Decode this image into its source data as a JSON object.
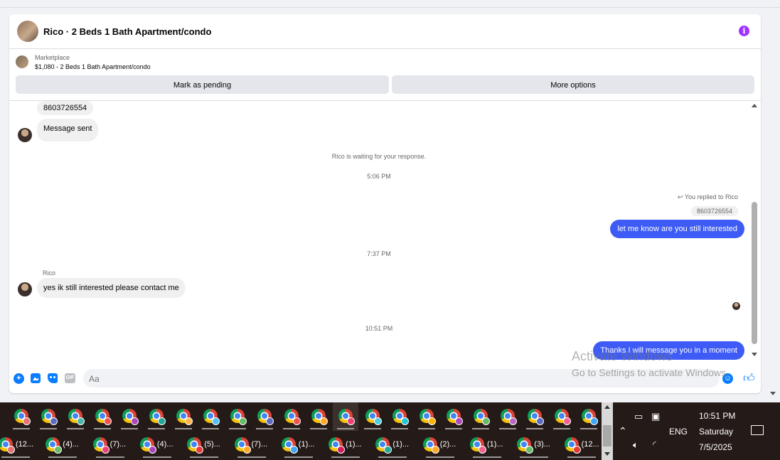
{
  "header": {
    "title": "Rico · 2 Beds 1 Bath Apartment/condo",
    "info_icon": "info-icon"
  },
  "listing": {
    "label": "Marketplace",
    "price_title": "$1,080 - 2 Beds 1 Bath Apartment/condo",
    "pending_label": "Mark as pending",
    "more_label": "More options"
  },
  "messages": {
    "phone_top": "8603726554",
    "message_sent": "Message sent",
    "waiting": "Rico is waiting for your response.",
    "time1": "5:06 PM",
    "replied_to": "You replied to Rico",
    "quoted_phone": "8603726554",
    "out1": "let me know are you still interested",
    "time2": "7:37 PM",
    "sender_name": "Rico",
    "in1": "yes ik still interested please contact me",
    "time3": "10:51 PM",
    "out2": "Thanks I will message you in a moment"
  },
  "composer": {
    "placeholder": "Aa",
    "gif_label": "GIF"
  },
  "watermark": {
    "line1": "Activate Windows",
    "line2": "Go to Settings to activate Windows."
  },
  "taskbar": {
    "row2_labels": [
      "(12...",
      "(4)...",
      "(7)...",
      "(4)...",
      "(5)...",
      "(7)...",
      "(1)...",
      "(1)...",
      "(1)...",
      "(2)...",
      "(1)...",
      "(3)...",
      "(12..."
    ],
    "badge_colors_row1": [
      "#e57373",
      "#5c6bc0",
      "#4db6ac",
      "#ef5350",
      "#ab47bc",
      "#26a69a",
      "#ffb74d",
      "#4fc3f7",
      "#66bb6a",
      "#5c6bc0",
      "#ef5350",
      "#ffa726",
      "#ec407a",
      "#4dd0e1",
      "#26c6da",
      "#ffb300",
      "#ab47bc",
      "#66bb6a",
      "#ba68c8",
      "#5c6bc0",
      "#f06292",
      "#42a5f5"
    ],
    "badge_colors_row2": [
      "#e57373",
      "#66bb6a",
      "#ec407a",
      "#ab47bc",
      "#e53935",
      "#ffa726",
      "#42a5f5",
      "#d81b60",
      "#26a69a",
      "#ffa726",
      "#f06292",
      "#66bb6a",
      "#e53935"
    ]
  },
  "tray": {
    "language": "ENG",
    "time": "10:51 PM",
    "day": "Saturday",
    "date": "7/5/2025"
  }
}
